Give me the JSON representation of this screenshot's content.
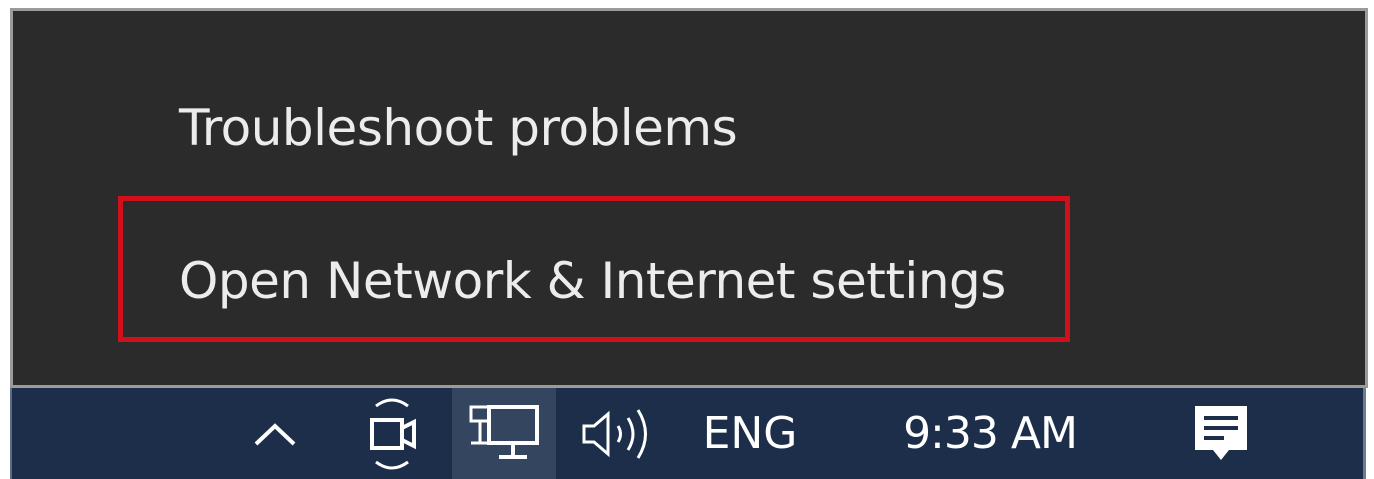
{
  "context_menu": {
    "items": [
      {
        "label": "Troubleshoot problems"
      },
      {
        "label": "Open Network & Internet settings",
        "highlighted": true
      }
    ],
    "highlight_color": "#d0111b"
  },
  "taskbar": {
    "background": "#1c2e4a",
    "tray_icons": [
      {
        "icon": "chevron-up-icon"
      },
      {
        "icon": "meet-now-icon"
      },
      {
        "icon": "network-wired-icon"
      },
      {
        "icon": "speaker-volume-icon"
      },
      {
        "icon": "notifications-icon"
      }
    ],
    "language": "ENG",
    "time": "9:33 AM"
  }
}
